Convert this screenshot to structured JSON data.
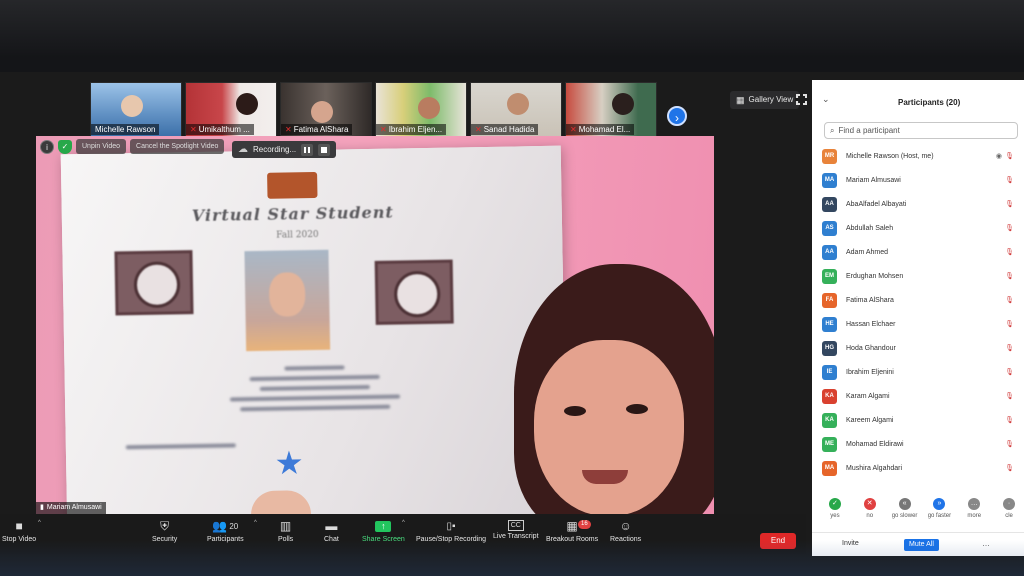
{
  "filmstrip": {
    "thumbs": [
      {
        "name": "Michelle Rawson",
        "muted": false
      },
      {
        "name": "Umikalthum ...",
        "muted": true
      },
      {
        "name": "Fatima AlShara",
        "muted": true
      },
      {
        "name": "Ibrahim Eljen...",
        "muted": true
      },
      {
        "name": "Sanad Hadida",
        "muted": true
      },
      {
        "name": "Mohamad El...",
        "muted": true
      }
    ],
    "next_icon": "chevron-right-icon",
    "gallery_view_label": "Gallery View"
  },
  "video_controls": {
    "unpin_label": "Unpin Video",
    "cancel_spotlight_label": "Cancel the Spotlight Video",
    "recording_label": "Recording..."
  },
  "certificate": {
    "title": "Virtual Star Student",
    "subtitle": "Fall 2020"
  },
  "speaker_name": "Mariam Almusawi",
  "toolbar": {
    "stop_video": "Stop Video",
    "security": "Security",
    "participants": "Participants",
    "participants_count": "20",
    "polls": "Polls",
    "chat": "Chat",
    "share_screen": "Share Screen",
    "pause_stop_recording": "Pause/Stop Recording",
    "live_transcript": "Live Transcript",
    "breakout_rooms": "Breakout Rooms",
    "breakout_badge": "16",
    "reactions": "Reactions",
    "end": "End"
  },
  "panel": {
    "title": "Participants (20)",
    "search_placeholder": "Find a participant",
    "participants": [
      {
        "initials": "MR",
        "name": "Michelle Rawson (Host, me)",
        "color": "#e8833a"
      },
      {
        "initials": "MA",
        "name": "Mariam Almusawi",
        "color": "#2f7fd0"
      },
      {
        "initials": "AA",
        "name": "AbaAlfadel Albayati",
        "color": "#334760"
      },
      {
        "initials": "AS",
        "name": "Abdullah Saleh",
        "color": "#2f7fd0"
      },
      {
        "initials": "AA",
        "name": "Adam Ahmed",
        "color": "#2f7fd0"
      },
      {
        "initials": "EM",
        "name": "Erdughan Mohsen",
        "color": "#35b05a"
      },
      {
        "initials": "FA",
        "name": "Fatima AlShara",
        "color": "#e6652a"
      },
      {
        "initials": "HE",
        "name": "Hassan Elchaer",
        "color": "#2f7fd0"
      },
      {
        "initials": "HG",
        "name": "Hoda Ghandour",
        "color": "#334760"
      },
      {
        "initials": "IE",
        "name": "Ibrahim Eljenini",
        "color": "#2f7fd0"
      },
      {
        "initials": "KA",
        "name": "Karam Algami",
        "color": "#d9412f"
      },
      {
        "initials": "KA",
        "name": "Kareem Algami",
        "color": "#35b05a"
      },
      {
        "initials": "ME",
        "name": "Mohamad Eldirawi",
        "color": "#35b05a"
      },
      {
        "initials": "MA",
        "name": "Mushira Algahdari",
        "color": "#e6652a"
      }
    ],
    "reactions": [
      {
        "label": "yes",
        "color": "#27a84a",
        "glyph": "✓"
      },
      {
        "label": "no",
        "color": "#e04141",
        "glyph": "✕"
      },
      {
        "label": "go slower",
        "color": "#777777",
        "glyph": "«"
      },
      {
        "label": "go faster",
        "color": "#1f74e8",
        "glyph": "»"
      },
      {
        "label": "more",
        "color": "#888888",
        "glyph": "…"
      },
      {
        "label": "cle",
        "color": "#888888",
        "glyph": "·"
      }
    ],
    "invite_label": "Invite",
    "mute_all_label": "Mute All"
  }
}
